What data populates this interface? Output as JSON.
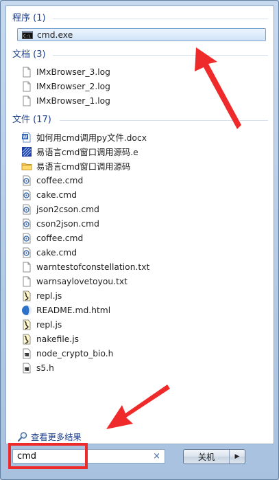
{
  "groups": [
    {
      "id": "programs",
      "header": "程序 (1)",
      "items": [
        {
          "label": "cmd.exe",
          "icon": "cmd-icon",
          "selected": true
        }
      ]
    },
    {
      "id": "documents",
      "header": "文档 (3)",
      "items": [
        {
          "label": "IMxBrowser_3.log",
          "icon": "text-file-icon"
        },
        {
          "label": "IMxBrowser_2.log",
          "icon": "text-file-icon"
        },
        {
          "label": "IMxBrowser_1.log",
          "icon": "text-file-icon"
        }
      ]
    },
    {
      "id": "files",
      "header": "文件 (17)",
      "items": [
        {
          "label": "如何用cmd调用py文件.docx",
          "icon": "word-icon"
        },
        {
          "label": "易语言cmd窗口调用源码.e",
          "icon": "e-source-icon"
        },
        {
          "label": "易语言cmd窗口调用源码",
          "icon": "folder-icon"
        },
        {
          "label": "coffee.cmd",
          "icon": "cmd-script-icon"
        },
        {
          "label": "cake.cmd",
          "icon": "cmd-script-icon"
        },
        {
          "label": "json2cson.cmd",
          "icon": "cmd-script-icon"
        },
        {
          "label": "cson2json.cmd",
          "icon": "cmd-script-icon"
        },
        {
          "label": "coffee.cmd",
          "icon": "cmd-script-icon"
        },
        {
          "label": "cake.cmd",
          "icon": "cmd-script-icon"
        },
        {
          "label": "warntestofconstellation.txt",
          "icon": "text-file-icon"
        },
        {
          "label": "warnsaylovetoyou.txt",
          "icon": "text-file-icon"
        },
        {
          "label": "repl.js",
          "icon": "js-file-icon"
        },
        {
          "label": "README.md.html",
          "icon": "html-file-icon"
        },
        {
          "label": "repl.js",
          "icon": "js-file-icon"
        },
        {
          "label": "nakefile.js",
          "icon": "js-file-icon"
        },
        {
          "label": "node_crypto_bio.h",
          "icon": "header-file-icon"
        },
        {
          "label": "s5.h",
          "icon": "header-file-icon"
        }
      ]
    }
  ],
  "see_more": {
    "label": "查看更多结果",
    "icon": "magnifier-icon"
  },
  "search": {
    "value": "cmd",
    "clear_icon": "clear-x-icon"
  },
  "shutdown": {
    "label": "关机",
    "arrow_icon": "triangle-right-icon"
  },
  "colors": {
    "header": "#1e3f8c",
    "annotation": "#ef2a2a"
  }
}
